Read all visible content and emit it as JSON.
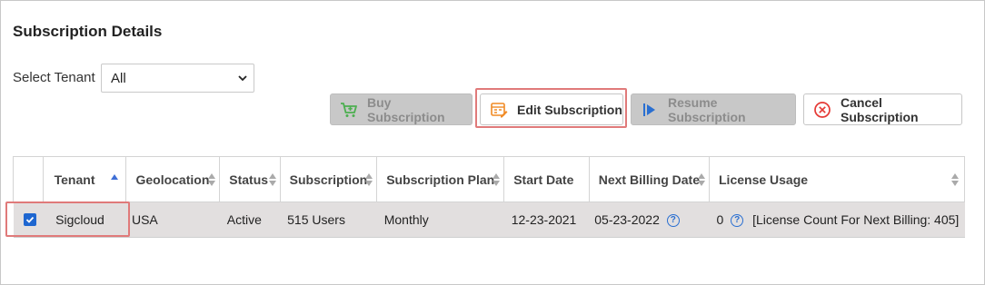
{
  "page": {
    "title": "Subscription Details"
  },
  "filter": {
    "label": "Select Tenant",
    "selected": "All"
  },
  "toolbar": {
    "buy_label": "Buy Subscription",
    "edit_label": "Edit Subscription",
    "resume_label": "Resume Subscription",
    "cancel_label": "Cancel Subscription"
  },
  "table": {
    "columns": [
      "Tenant",
      "Geolocation",
      "Status",
      "Subscription",
      "Subscription Plan",
      "Start Date",
      "Next Billing Date",
      "License Usage"
    ],
    "rows": [
      {
        "selected": true,
        "tenant": "Sigcloud",
        "geolocation": "USA",
        "status": "Active",
        "subscription": "515 Users",
        "plan": "Monthly",
        "start_date": "12-23-2021",
        "next_billing": "05-23-2022",
        "license_count": "0",
        "license_note": "[License Count For Next Billing: 405]"
      }
    ]
  },
  "colors": {
    "highlight": "#e07a7a",
    "checkbox": "#1e66d0",
    "help": "#2a6fd1",
    "cart_icon": "#4caf50",
    "edit_icon": "#f08a24",
    "resume_icon": "#2a6fd1",
    "cancel_icon": "#e53935"
  }
}
